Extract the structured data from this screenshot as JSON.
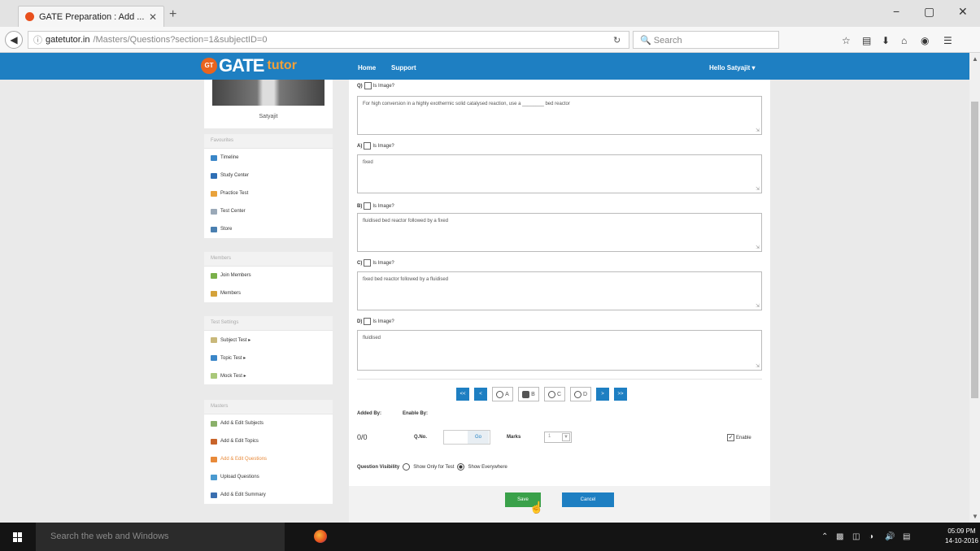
{
  "browser": {
    "tab_title": "GATE Preparation : Add ...",
    "tab_close": "✕",
    "new_tab": "+",
    "url_domain": "gatetutor.in",
    "url_path": "/Masters/Questions?section=1&subjectID=0",
    "search_placeholder": "Search",
    "win_minimize": "−",
    "win_maximize": "▢",
    "win_close": "✕"
  },
  "header": {
    "logo_badge": "GT",
    "logo_gate": "GATE",
    "logo_tutor": "tutor",
    "home": "Home",
    "support": "Support",
    "greeting": "Hello Satyajit ▾"
  },
  "sidebar": {
    "profile_name": "Satyajit",
    "favourites": {
      "title": "Favourites",
      "items": [
        {
          "label": "Timeline",
          "color": "#3a86c8"
        },
        {
          "label": "Study Center",
          "color": "#2f6fb5"
        },
        {
          "label": "Practice Test",
          "color": "#e9a23b"
        },
        {
          "label": "Test Center",
          "color": "#9aa9b8"
        },
        {
          "label": "Store",
          "color": "#4a7fb0"
        }
      ]
    },
    "members": {
      "title": "Members",
      "items": [
        {
          "label": "Join Members",
          "color": "#7ab04a"
        },
        {
          "label": "Members",
          "color": "#d4a23a"
        }
      ]
    },
    "test_settings": {
      "title": "Test Settings",
      "items": [
        {
          "label": "Subject Test ▸",
          "color": "#c9b87a"
        },
        {
          "label": "Topic Test ▸",
          "color": "#3a86c8"
        },
        {
          "label": "Mock Test ▸",
          "color": "#a9c87a"
        }
      ]
    },
    "masters": {
      "title": "Masters",
      "items": [
        {
          "label": "Add & Edit Subjects",
          "color": "#8ab06a"
        },
        {
          "label": "Add & Edit Topics",
          "color": "#c8642a"
        },
        {
          "label": "Add & Edit Questions",
          "color": "#e88a3a",
          "active": true
        },
        {
          "label": "Upload Questions",
          "color": "#4a9ad0"
        },
        {
          "label": "Add & Edit Summary",
          "color": "#3a6fb0"
        }
      ]
    }
  },
  "form": {
    "question": {
      "label": "Q)",
      "is_image": "Is Image?",
      "text": "For high conversion in a highly exothermic solid catalysed reaction, use a ________ bed reactor"
    },
    "option_a": {
      "label": "A)",
      "is_image": "Is Image?",
      "text": "fixed"
    },
    "option_b": {
      "label": "B)",
      "is_image": "Is Image?",
      "text": "fluidised bed reactor followed by a fixed"
    },
    "option_c": {
      "label": "C)",
      "is_image": "Is Image?",
      "text": "fixed bed reactor followed by a fluidised"
    },
    "option_d": {
      "label": "D)",
      "is_image": "Is Image?",
      "text": "fluidised"
    },
    "pager": {
      "first": "<<",
      "prev": "<",
      "next": ">",
      "last": ">>",
      "answers": [
        "A",
        "B",
        "C",
        "D"
      ],
      "selected": "B"
    },
    "added_by": "Added By:",
    "enable_by": "Enable By:",
    "count": "0/0",
    "qno_label": "Q.No.",
    "go": "Go",
    "marks_label": "Marks",
    "marks_value": "1",
    "enable_label": "Enable",
    "enable_checked": "✓",
    "visibility_label": "Question Visibility",
    "visibility_test": "Show Only for Test",
    "visibility_everywhere": "Show Everywhere",
    "save": "Save",
    "cancel": "Cancel"
  },
  "taskbar": {
    "search": "Search the web and Windows",
    "time": "05:09 PM",
    "date": "14-10-2016"
  }
}
